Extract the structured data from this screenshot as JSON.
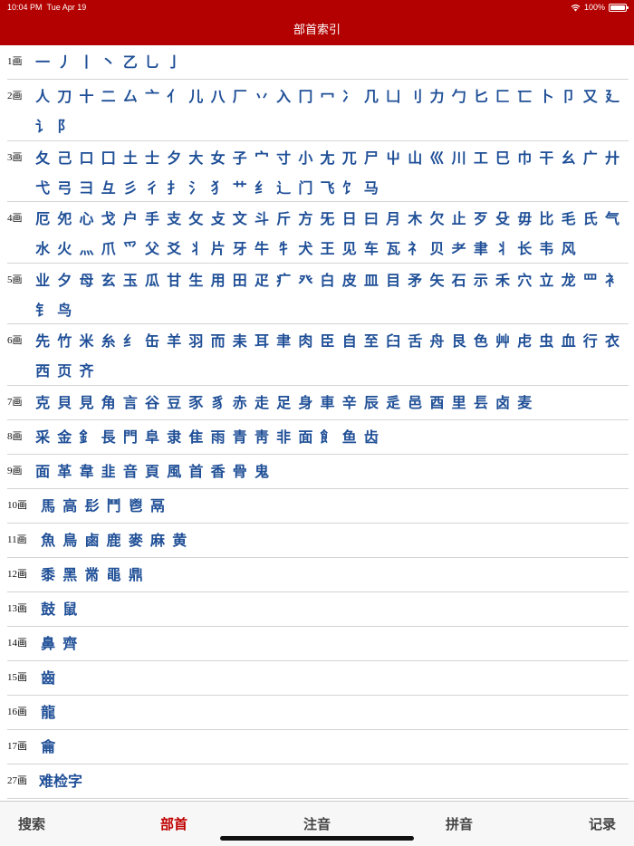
{
  "status_bar": {
    "time": "10:04 PM",
    "date": "Tue Apr 19",
    "battery": "100%",
    "battery_level": 1.0
  },
  "nav": {
    "title": "部首索引"
  },
  "rows": [
    {
      "label": "1画",
      "chars": [
        "一",
        "丿",
        "丨",
        "丶",
        "乙",
        "乚",
        "亅"
      ]
    },
    {
      "label": "2画",
      "chars": [
        "人",
        "刀",
        "十",
        "二",
        "厶",
        "亠",
        "亻",
        "儿",
        "八",
        "厂",
        "丷",
        "入",
        "冂",
        "冖",
        "冫",
        "几",
        "凵",
        "刂",
        "力",
        "勹",
        "匕",
        "匚",
        "匸",
        "卜",
        "卩",
        "又",
        "廴",
        "讠",
        "阝"
      ]
    },
    {
      "label": "3画",
      "chars": [
        "夂",
        "己",
        "口",
        "囗",
        "土",
        "士",
        "夕",
        "大",
        "女",
        "子",
        "宀",
        "寸",
        "小",
        "尢",
        "兀",
        "尸",
        "屮",
        "山",
        "巛",
        "川",
        "工",
        "巳",
        "巾",
        "干",
        "幺",
        "广",
        "廾",
        "弋",
        "弓",
        "彐",
        "彑",
        "彡",
        "彳",
        "扌",
        "氵",
        "犭",
        "艹",
        "纟",
        "辶",
        "门",
        "飞",
        "饣",
        "马"
      ]
    },
    {
      "label": "4画",
      "chars": [
        "厄",
        "夗",
        "心",
        "戈",
        "户",
        "手",
        "支",
        "攵",
        "攴",
        "文",
        "斗",
        "斤",
        "方",
        "旡",
        "日",
        "曰",
        "月",
        "木",
        "欠",
        "止",
        "歹",
        "殳",
        "毋",
        "比",
        "毛",
        "氏",
        "气",
        "水",
        "火",
        "灬",
        "爪",
        "爫",
        "父",
        "爻",
        "丬",
        "片",
        "牙",
        "牛",
        "牜",
        "犬",
        "王",
        "见",
        "车",
        "瓦",
        "礻",
        "贝",
        "耂",
        "聿",
        "丬",
        "长",
        "韦",
        "风"
      ]
    },
    {
      "label": "5画",
      "chars": [
        "业",
        "夕",
        "母",
        "玄",
        "玉",
        "瓜",
        "甘",
        "生",
        "用",
        "田",
        "疋",
        "疒",
        "癶",
        "白",
        "皮",
        "皿",
        "目",
        "矛",
        "矢",
        "石",
        "示",
        "禾",
        "穴",
        "立",
        "龙",
        "罒",
        "衤",
        "钅",
        "鸟"
      ]
    },
    {
      "label": "6画",
      "chars": [
        "先",
        "竹",
        "米",
        "糸",
        "纟",
        "缶",
        "羊",
        "羽",
        "而",
        "耒",
        "耳",
        "聿",
        "肉",
        "臣",
        "自",
        "至",
        "臼",
        "舌",
        "舟",
        "艮",
        "色",
        "艸",
        "虍",
        "虫",
        "血",
        "行",
        "衣",
        "西",
        "页",
        "齐"
      ]
    },
    {
      "label": "7画",
      "chars": [
        "克",
        "貝",
        "見",
        "角",
        "言",
        "谷",
        "豆",
        "豕",
        "豸",
        "赤",
        "走",
        "足",
        "身",
        "車",
        "辛",
        "辰",
        "辵",
        "邑",
        "酉",
        "里",
        "镸",
        "卤",
        "麦"
      ]
    },
    {
      "label": "8画",
      "chars": [
        "采",
        "金",
        "釒",
        "長",
        "門",
        "阜",
        "隶",
        "隹",
        "雨",
        "青",
        "靑",
        "非",
        "面",
        "飠",
        "鱼",
        "齿"
      ]
    },
    {
      "label": "9画",
      "chars": [
        "面",
        "革",
        "韋",
        "韭",
        "音",
        "頁",
        "風",
        "首",
        "香",
        "骨",
        "鬼"
      ]
    },
    {
      "label": "10画",
      "chars": [
        "馬",
        "高",
        "髟",
        "鬥",
        "鬯",
        "鬲"
      ]
    },
    {
      "label": "11画",
      "chars": [
        "魚",
        "鳥",
        "鹵",
        "鹿",
        "麥",
        "麻",
        "黄"
      ]
    },
    {
      "label": "12画",
      "chars": [
        "黍",
        "黑",
        "黹",
        "黽",
        "鼎"
      ]
    },
    {
      "label": "13画",
      "chars": [
        "鼓",
        "鼠"
      ]
    },
    {
      "label": "14画",
      "chars": [
        "鼻",
        "齊"
      ]
    },
    {
      "label": "15画",
      "chars": [
        "齒"
      ]
    },
    {
      "label": "16画",
      "chars": [
        "龍"
      ]
    },
    {
      "label": "17画",
      "chars": [
        "龠"
      ]
    },
    {
      "label": "27画",
      "chars": [
        "难检字"
      ]
    }
  ],
  "tabs": {
    "search": "搜索",
    "radical": "部首",
    "zhuyin": "注音",
    "pinyin": "拼音",
    "records": "记录"
  },
  "colors": {
    "accent": "#b30000",
    "char_blue": "#1f4f97",
    "active_tab": "#c00000"
  }
}
